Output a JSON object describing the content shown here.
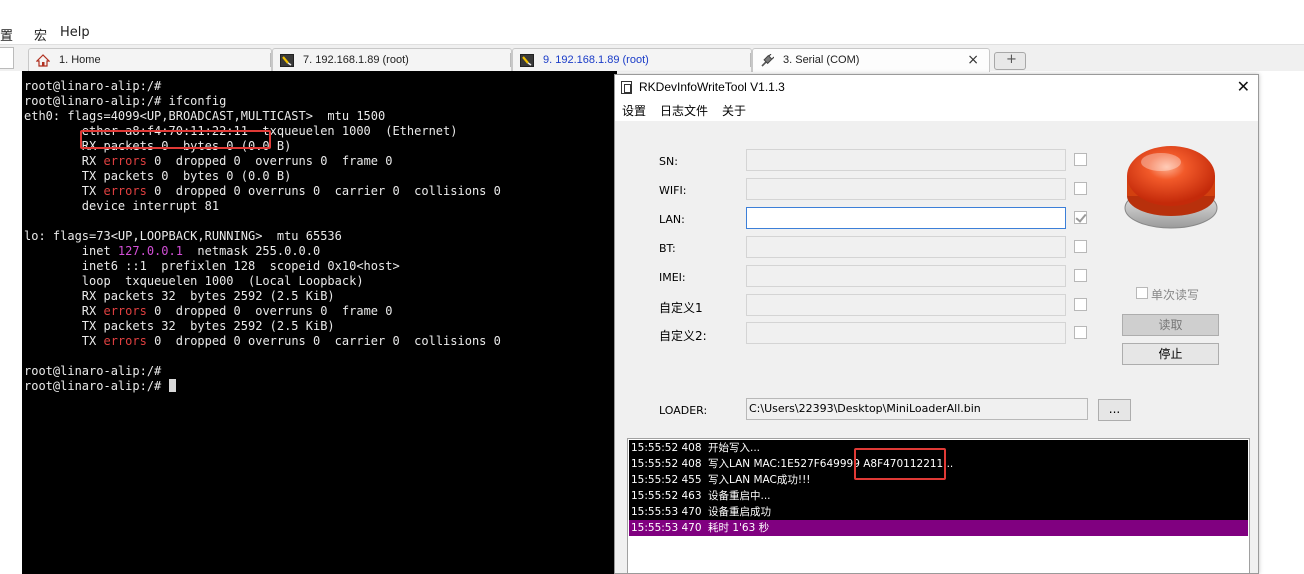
{
  "menubar": {
    "item1": "置",
    "item2": "宏",
    "item3": "Help"
  },
  "tabs": [
    {
      "label": "1. Home",
      "icon": "home-icon"
    },
    {
      "label": "7. 192.168.1.89 (root)",
      "icon": "terminal-session-icon"
    },
    {
      "label": "9. 192.168.1.89 (root)",
      "icon": "terminal-session-icon"
    },
    {
      "label": "3. Serial (COM)",
      "icon": "serial-plug-icon",
      "close": "×"
    }
  ],
  "new_tab": "+",
  "terminal": {
    "lines": [
      "root@linaro-alip:/#",
      "root@linaro-alip:/# ifconfig",
      "eth0: flags=4099<UP,BROADCAST,MULTICAST>  mtu 1500",
      "        ether a8:f4:70:11:22:11  txqueuelen 1000  (Ethernet)",
      "        RX packets 0  bytes 0 (0.0 B)",
      "        RX errors 0  dropped 0  overruns 0  frame 0",
      "        TX packets 0  bytes 0 (0.0 B)",
      "        TX errors 0  dropped 0 overruns 0  carrier 0  collisions 0",
      "        device interrupt 81",
      "",
      "lo: flags=73<UP,LOOPBACK,RUNNING>  mtu 65536",
      "        inet 127.0.0.1  netmask 255.0.0.0",
      "        inet6 ::1  prefixlen 128  scopeid 0x10<host>",
      "        loop  txqueuelen 1000  (Local Loopback)",
      "        RX packets 32  bytes 2592 (2.5 KiB)",
      "        RX errors 0  dropped 0  overruns 0  frame 0",
      "        TX packets 32  bytes 2592 (2.5 KiB)",
      "        TX errors 0  dropped 0 overruns 0  carrier 0  collisions 0",
      "",
      "root@linaro-alip:/#",
      "root@linaro-alip:/# "
    ],
    "highlight_words": [
      "errors"
    ],
    "highlight_ip": "127.0.0.1",
    "colors": {
      "background": "#000000",
      "text": "#eaeaea",
      "error": "#e04040",
      "ip": "#d24fd6"
    }
  },
  "dialog": {
    "title": "RKDevInfoWriteTool V1.1.3",
    "close": "✕",
    "menu": [
      "设置",
      "日志文件",
      "关于"
    ],
    "fields": [
      {
        "label": "SN:",
        "value": "",
        "checked": false,
        "active": false
      },
      {
        "label": "WIFI:",
        "value": "",
        "checked": false,
        "active": false
      },
      {
        "label": "LAN:",
        "value": "",
        "checked": true,
        "active": true
      },
      {
        "label": "BT:",
        "value": "",
        "checked": false,
        "active": false
      },
      {
        "label": "IMEI:",
        "value": "",
        "checked": false,
        "active": false
      },
      {
        "label": "自定义1",
        "value": "",
        "checked": false,
        "active": false
      },
      {
        "label": "自定义2:",
        "value": "",
        "checked": false,
        "active": false
      }
    ],
    "loader": {
      "label": "LOADER:",
      "value": "C:\\Users\\22393\\Desktop\\MiniLoaderAll.bin",
      "browse": "..."
    },
    "single_read_label": "单次读写",
    "read_button": "读取",
    "stop_button": "停止",
    "log": [
      {
        "time": "15:55:52 408",
        "msg": "开始写入..."
      },
      {
        "time": "15:55:52 408",
        "msg": "写入LAN MAC:1E527F649999 A8F470112211..."
      },
      {
        "time": "15:55:52 455",
        "msg": "写入LAN MAC成功!!!"
      },
      {
        "time": "15:55:52 463",
        "msg": "设备重启中..."
      },
      {
        "time": "15:55:53 470",
        "msg": "设备重启成功"
      },
      {
        "time": "15:55:53 470",
        "msg": "耗时 1'63 秒"
      }
    ],
    "colors": {
      "accent_red": "#e03a36",
      "log_highlight": "#800080",
      "big_button": "#e8461e"
    }
  }
}
